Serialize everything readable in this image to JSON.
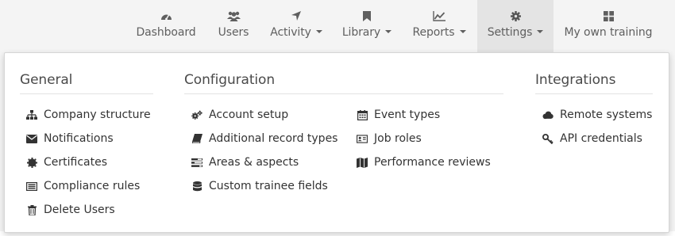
{
  "nav": {
    "items": [
      {
        "label": "Dashboard",
        "icon": "dashboard-icon",
        "dropdown": false
      },
      {
        "label": "Users",
        "icon": "users-icon",
        "dropdown": false
      },
      {
        "label": "Activity",
        "icon": "location-arrow-icon",
        "dropdown": true
      },
      {
        "label": "Library",
        "icon": "bookmark-icon",
        "dropdown": true
      },
      {
        "label": "Reports",
        "icon": "line-chart-icon",
        "dropdown": true
      },
      {
        "label": "Settings",
        "icon": "gear-icon",
        "dropdown": true,
        "active": true
      },
      {
        "label": "My own training",
        "icon": "grid-icon",
        "dropdown": false
      }
    ]
  },
  "settings_menu": {
    "general": {
      "title": "General",
      "items": [
        {
          "label": "Company structure",
          "icon": "sitemap-icon"
        },
        {
          "label": "Notifications",
          "icon": "envelope-icon"
        },
        {
          "label": "Certificates",
          "icon": "certificate-icon"
        },
        {
          "label": "Compliance rules",
          "icon": "list-alt-icon"
        },
        {
          "label": "Delete Users",
          "icon": "trash-icon"
        }
      ]
    },
    "configuration": {
      "title": "Configuration",
      "col1": [
        {
          "label": "Account setup",
          "icon": "cogs-icon"
        },
        {
          "label": "Additional record types",
          "icon": "book-icon"
        },
        {
          "label": "Areas & aspects",
          "icon": "tasks-icon"
        },
        {
          "label": "Custom trainee fields",
          "icon": "database-icon"
        }
      ],
      "col2": [
        {
          "label": "Event types",
          "icon": "calendar-icon"
        },
        {
          "label": "Job roles",
          "icon": "id-card-icon"
        },
        {
          "label": "Performance reviews",
          "icon": "map-icon"
        }
      ]
    },
    "integrations": {
      "title": "Integrations",
      "items": [
        {
          "label": "Remote systems",
          "icon": "cloud-icon"
        },
        {
          "label": "API credentials",
          "icon": "key-icon"
        }
      ]
    }
  },
  "colors": {
    "nav_bg": "#f4f4f4",
    "nav_active_bg": "#e4e4e4",
    "nav_text": "#5f5f5f",
    "panel_bg": "#ffffff",
    "item_text": "#333333"
  }
}
